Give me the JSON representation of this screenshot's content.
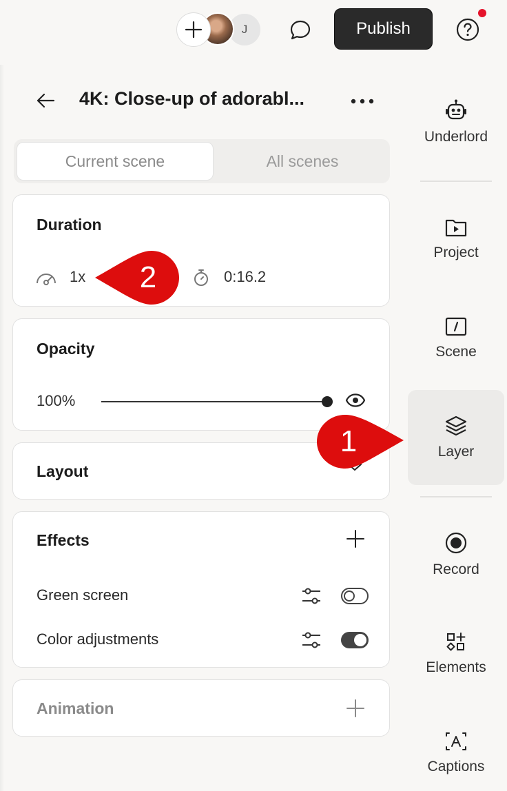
{
  "topbar": {
    "avatar_initial": "J",
    "publish_label": "Publish",
    "help_icon": "question-circle-icon",
    "comment_icon": "chat-bubble-icon",
    "notification_color": "#e5132b"
  },
  "header": {
    "title": "4K: Close-up of adorabl..."
  },
  "scene_tabs": {
    "current": "Current scene",
    "all": "All scenes"
  },
  "duration": {
    "title": "Duration",
    "speed": "1x",
    "length": "0:16.2"
  },
  "opacity": {
    "title": "Opacity",
    "value_label": "100%",
    "value_fraction": 1.0
  },
  "layout": {
    "title": "Layout"
  },
  "effects": {
    "title": "Effects",
    "items": [
      {
        "label": "Green screen",
        "enabled": false
      },
      {
        "label": "Color adjustments",
        "enabled": true
      }
    ]
  },
  "animation": {
    "title": "Animation"
  },
  "rail": {
    "items": [
      {
        "label": "Underlord",
        "icon": "robot-icon"
      },
      {
        "label": "Project",
        "icon": "folder-play-icon"
      },
      {
        "label": "Scene",
        "icon": "scene-slash-icon"
      },
      {
        "label": "Layer",
        "icon": "layers-icon",
        "active": true
      },
      {
        "label": "Record",
        "icon": "record-icon"
      },
      {
        "label": "Elements",
        "icon": "shapes-icon"
      },
      {
        "label": "Captions",
        "icon": "captions-icon"
      }
    ]
  },
  "callouts": {
    "one": "1",
    "two": "2",
    "color": "#dd0d0d"
  }
}
